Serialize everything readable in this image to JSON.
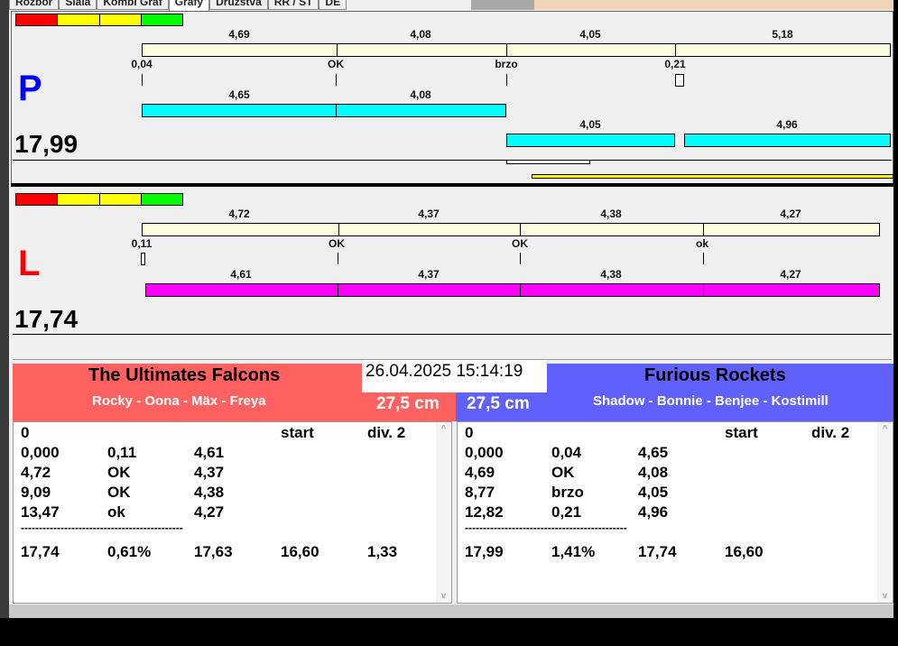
{
  "tabs": [
    "Rozbor",
    "Siala",
    "Kombi Graf",
    "Grafy",
    "Družstva",
    "RR / ST",
    "DE"
  ],
  "scale_colors": [
    "#ff0000",
    "#ffff00",
    "#ffff00",
    "#00ff00"
  ],
  "lanes": {
    "P": {
      "letter": "P",
      "color": "#0000ff",
      "total": "17,99",
      "top_bar": [
        "4,69",
        "4,08",
        "4,05",
        "5,18"
      ],
      "ticks": [
        "0,04",
        "OK",
        "brzo",
        "0,21"
      ],
      "cyan_row1": [
        "4,65",
        "4,08"
      ],
      "cyan_row2": [
        "4,05",
        "4,96"
      ]
    },
    "L": {
      "letter": "L",
      "color": "#ff0000",
      "total": "17,74",
      "top_bar": [
        "4,72",
        "4,37",
        "4,38",
        "4,27"
      ],
      "ticks": [
        "0,11",
        "OK",
        "OK",
        "ok"
      ],
      "magenta_row": [
        "4,61",
        "4,37",
        "4,38",
        "4,27"
      ]
    }
  },
  "datetime": "26.04.2025 15:14:19",
  "teams": {
    "left": {
      "name": "The Ultimates Falcons",
      "players": "Rocky - Oona - Mäx - Freya",
      "distance": "27,5 cm",
      "color": "#ff6060",
      "header": [
        "0",
        "",
        "",
        "start",
        "div. 2"
      ],
      "rows": [
        [
          "0,000",
          "0,11",
          "4,61"
        ],
        [
          "4,72",
          "OK",
          "4,37"
        ],
        [
          "9,09",
          "OK",
          "4,38"
        ],
        [
          "13,47",
          "ok",
          "4,27"
        ]
      ],
      "separator": "---------------------------------------------",
      "totals": [
        "17,74",
        "0,61%",
        "17,63",
        "16,60",
        "1,33"
      ]
    },
    "right": {
      "name": "Furious Rockets",
      "players": "Shadow - Bonnie - Benjee - Kostimill",
      "distance": "27,5 cm",
      "color": "#6060ff",
      "header": [
        "0",
        "",
        "",
        "start",
        "div. 2"
      ],
      "rows": [
        [
          "0,000",
          "0,04",
          "4,65"
        ],
        [
          "4,69",
          "OK",
          "4,08"
        ],
        [
          "8,77",
          "brzo",
          "4,05"
        ],
        [
          "12,82",
          "0,21",
          "4,96"
        ]
      ],
      "separator": "---------------------------------------------",
      "totals": [
        "17,99",
        "1,41%",
        "17,74",
        "16,60"
      ]
    }
  }
}
